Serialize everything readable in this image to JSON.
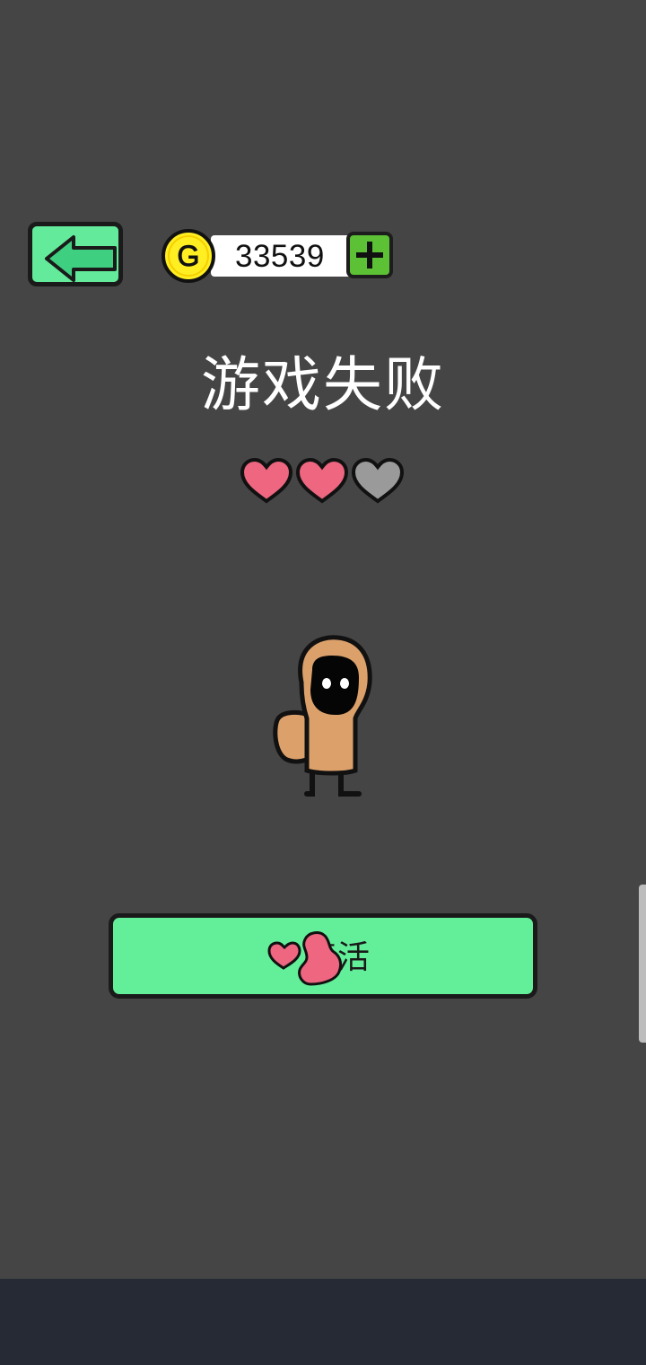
{
  "coins": {
    "value": "33539"
  },
  "title": "游戏失败",
  "lives": {
    "filled": 2,
    "total": 3
  },
  "revive_button": {
    "label": "复活"
  },
  "colors": {
    "background": "#454545",
    "button_green": "#63ea9a",
    "heart_filled": "#ee6680",
    "heart_empty": "#9a9a9a",
    "coin_yellow": "#ffee22",
    "add_green": "#5cc135",
    "nav_bar": "#262a34"
  },
  "icons": {
    "back": "left-arrow-icon",
    "coin": "coin-g-icon",
    "add": "plus-icon",
    "heart": "heart-icon"
  }
}
